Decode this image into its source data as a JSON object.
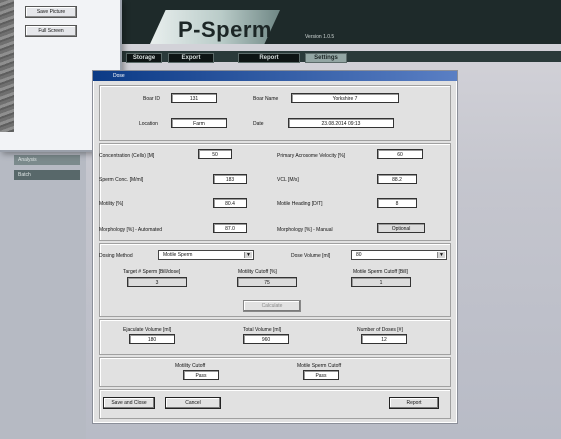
{
  "app": {
    "title": "P-Sperm",
    "version": "Version 1.0.5"
  },
  "nav": {
    "items": [
      "Storage",
      "Export",
      "Report",
      "Settings"
    ]
  },
  "preview": {
    "buttons": [
      "Save Picture",
      "Full Screen"
    ]
  },
  "sidebar": {
    "items": [
      "Analysis",
      "Batch"
    ]
  },
  "dialog": {
    "title": "Dose",
    "boar_id_label": "Boar ID",
    "boar_id_value": "131",
    "boar_name_label": "Boar Name",
    "boar_name_value": "Yorkshire 7",
    "location_label": "Location",
    "location_value": "Farm",
    "date_label": "Date",
    "date_value": "23.08.2014 09:13",
    "metrics": {
      "concentration_label": "Concentration (Cells) [M]",
      "concentration_value": "50",
      "pmv_label": "Primary Acrosome Velocity [%]",
      "pmv_value": "60",
      "sperm_conc_label": "Sperm Conc. [M/ml]",
      "sperm_conc_value": "183",
      "vcl_label": "VCL [M/s]",
      "vcl_value": "88.2",
      "motility_label": "Motility [%]",
      "motility_value": "80.4",
      "motile_head_label": "Motile Heading [D/T]",
      "motile_head_value": "8",
      "morph_auto_label": "Morphology [%] - Automated",
      "morph_auto_value": "87.0",
      "morph_manual_label": "Morphology [%] - Manual",
      "morph_manual_button": "Optional"
    },
    "dose": {
      "method_label": "Dosing Method",
      "method_value": "Motile Sperm",
      "volume_label": "Dose Volume [ml]",
      "volume_value": "80",
      "target_label": "Target # Sperm [Bill/dose]",
      "target_value": "3",
      "cutoff_label": "Motility Cutoff [%]",
      "cutoff_value": "75",
      "motile_cutoff_label": "Motile Sperm Cutoff [Bill]",
      "motile_cutoff_value": "1",
      "calculate_button": "Calculate"
    },
    "results": {
      "ejac_label": "Ejaculate Volume [ml]",
      "ejac_value": "180",
      "total_label": "Total Volume [ml]",
      "total_value": "960",
      "doses_label": "Number of Doses [#]",
      "doses_value": "12"
    },
    "status": {
      "motility_cutoff_label": "Motility Cutoff",
      "motility_cutoff_value": "Pass",
      "motile_sperm_cutoff_label": "Motile Sperm Cutoff",
      "motile_sperm_cutoff_value": "Pass"
    },
    "buttons": {
      "save_close": "Save and Close",
      "cancel": "Cancel",
      "report": "Report"
    }
  }
}
